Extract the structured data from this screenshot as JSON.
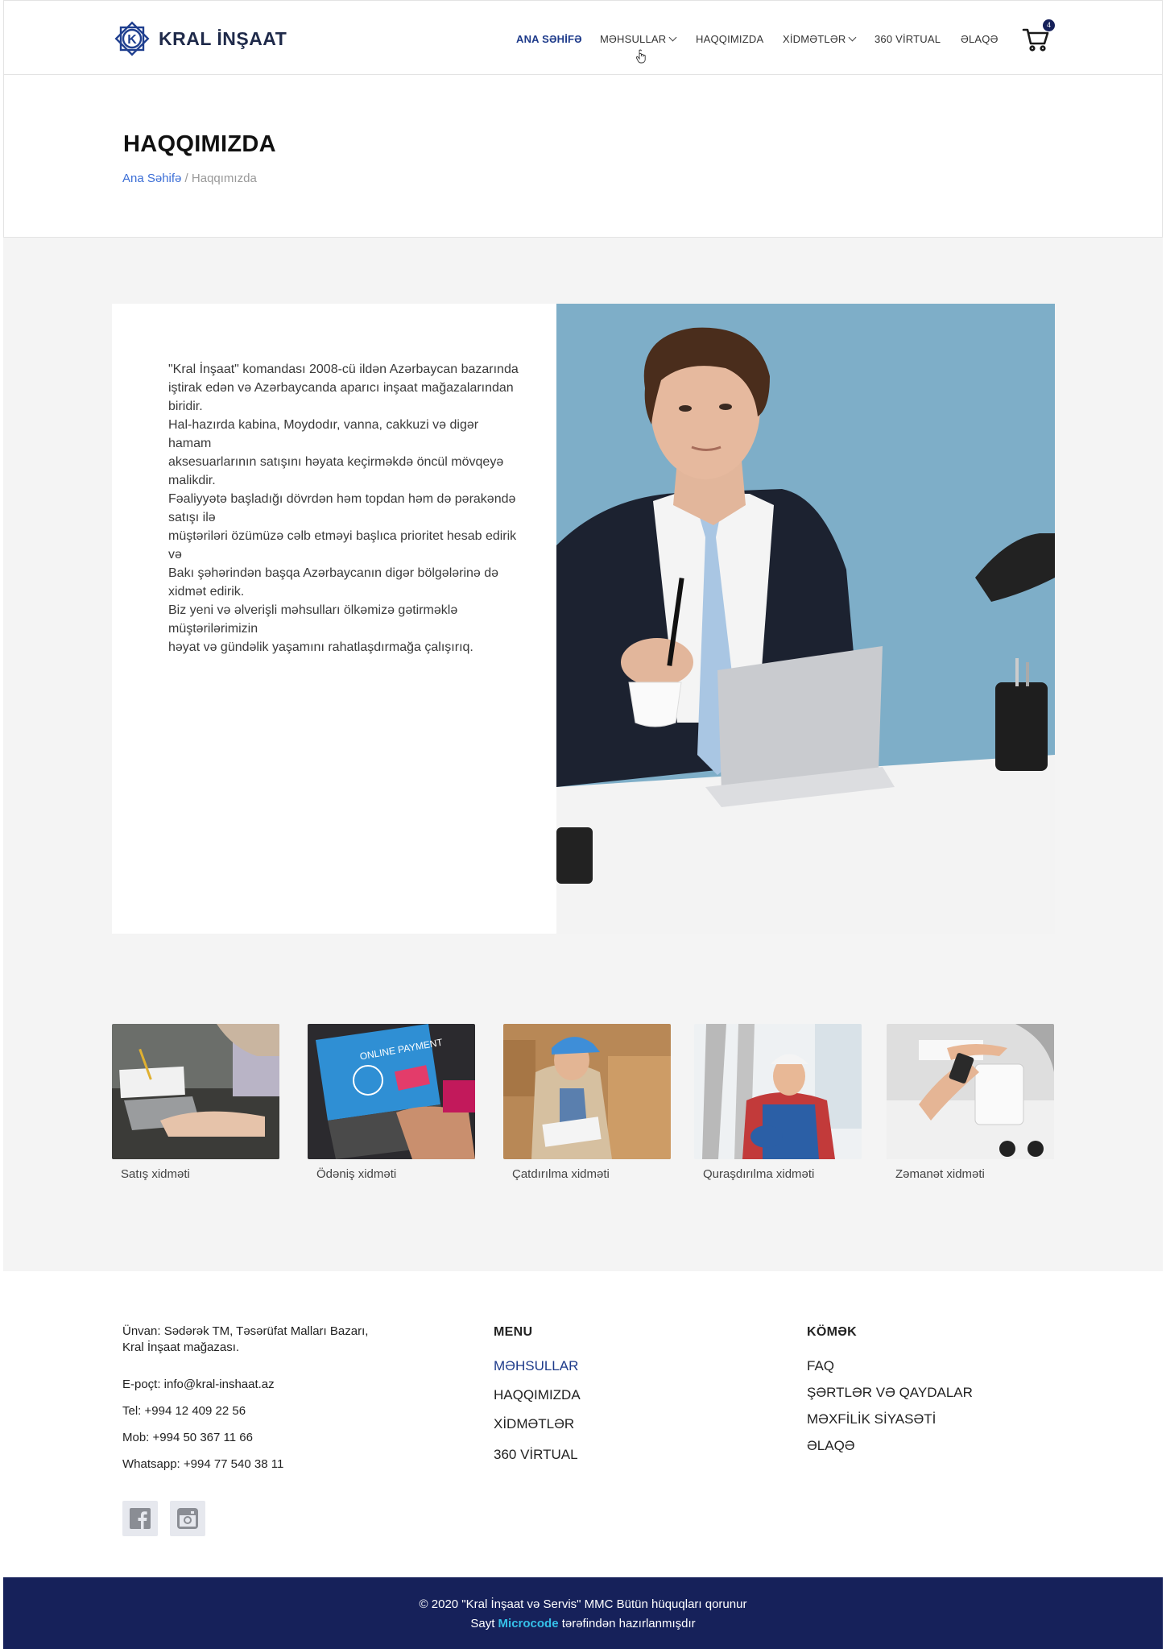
{
  "header": {
    "logo_text": "KRAL İNŞAAT",
    "nav": [
      {
        "label": "ANA SƏHİFƏ",
        "active": true,
        "dropdown": false
      },
      {
        "label": "MƏHSULLAR",
        "active": false,
        "dropdown": true
      },
      {
        "label": "HAQQIMIZDA",
        "active": false,
        "dropdown": false
      },
      {
        "label": "XİDMƏTLƏR",
        "active": false,
        "dropdown": true
      },
      {
        "label": "360 VİRTUAL",
        "active": false,
        "dropdown": false
      },
      {
        "label": "ƏLAQƏ",
        "active": false,
        "dropdown": false
      }
    ],
    "cart_count": "4"
  },
  "title_section": {
    "title": "HAQQIMIZDA",
    "breadcrumb_home": "Ana Səhifə",
    "breadcrumb_separator": " / ",
    "breadcrumb_current": "Haqqımızda"
  },
  "about": {
    "text": "\"Kral İnşaat\" komandası 2008-cü ildən Azərbaycan bazarında\niştirak edən və Azərbaycanda aparıcı inşaat mağazalarından biridir.\n Hal-hazırda kabina, Moydodır, vanna, cakkuzi və digər hamam\naksesuarlarının satışını həyata keçirməkdə öncül mövqeyə malikdir.\nFəaliyyətə başladığı dövrdən həm topdan həm də pərakəndə satışı ilə\nmüştəriləri özümüzə cəlb etməyi başlıca prioritet hesab edirik və\nBakı şəhərindən başqa Azərbaycanın digər bölgələrinə də xidmət edirik.\nBiz yeni və əlverişli məhsulları ölkəmizə gətirməklə müştərilərimizin\nhəyat və gündəlik yaşamını rahatlaşdırmağa çalışırıq."
  },
  "services": [
    {
      "label": "Satış xidməti"
    },
    {
      "label": "Ödəniş xidməti",
      "image_text": "ONLINE PAYMENT"
    },
    {
      "label": "Çatdırılma xidməti"
    },
    {
      "label": "Quraşdırılma xidməti"
    },
    {
      "label": "Zəmanət xidməti"
    }
  ],
  "footer": {
    "address": "Ünvan:  Sədərək TM, Təsərüfat Malları Bazarı, Kral İnşaat mağazası.",
    "email": "E-poçt: info@kral-inshaat.az",
    "tel": "Tel: +994 12 409 22 56",
    "mob": "Mob: +994 50 367 11 66",
    "whatsapp": "Whatsapp: +994 77 540 38 11",
    "social": [
      "facebook-icon",
      "instagram-icon"
    ],
    "menu_heading": "MENU",
    "menu": [
      "MƏHSULLAR",
      "HAQQIMIZDA",
      "XİDMƏTLƏR",
      "360 VİRTUAL"
    ],
    "help_heading": "KÖMƏK",
    "help": [
      "FAQ",
      "ŞƏRTLƏR VƏ QAYDALAR",
      "MƏXFİLİK SİYASƏTİ",
      "ƏLAQƏ"
    ],
    "copyright": "© 2020 \"Kral İnşaat və Servis\" MMC Bütün hüquqları qorunur",
    "made_by_prefix": "Sayt ",
    "made_by_brand": "Microcode",
    "made_by_suffix": " tərəfindən hazırlanmışdır"
  },
  "colors": {
    "primary": "#16215a",
    "accent_link": "#3b6ed6",
    "brand_highlight": "#35c0e8",
    "section_bg": "#f4f4f4"
  }
}
